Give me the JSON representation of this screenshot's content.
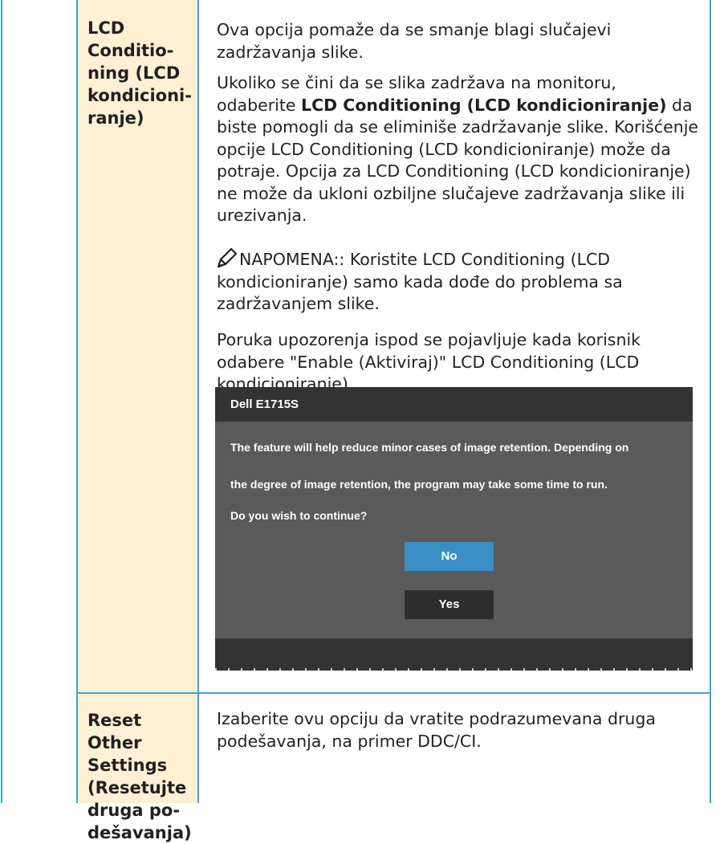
{
  "rows": [
    {
      "setting": "LCD Conditio-\nning (LCD\nkondicioni-\nranje)",
      "paragraphs": [
        "Ova opcija pomaže da se smanje blagi slučajevi zadržavanja slike.",
        {
          "before": "Ukoliko se čini da se slika zadržava na monitoru, odaberite ",
          "bold": "LCD Conditioning (LCD kondicioniranje)",
          "after": " da biste pomogli da se eliminiše zadržavanje slike. Korišćenje opcije LCD Conditioning (LCD kondicioniranje) može da potraje. Opcija za LCD Conditioning (LCD kondicioniranje) ne može da ukloni ozbiljne slučajeve zadržavanja slike ili urezivanja."
        }
      ],
      "note": {
        "label": "NAPOMENA:",
        "text": ": Koristite LCD Conditioning (LCD kondicioniranje) samo kada dođe do problema sa zadržavanjem slike."
      },
      "warning_intro": "Poruka upozorenja ispod se pojavljuje kada korisnik odabere \"Enable (Aktiviraj)\" LCD Conditioning (LCD kondicioniranje).",
      "dialog": {
        "title": "Dell E1715S",
        "line1": "The feature will help reduce minor cases of image retention. Depending on",
        "line2": "the degree of image retention, the program may take some time to run.",
        "line3": "Do you wish to continue?",
        "no_label": "No",
        "yes_label": "Yes"
      }
    },
    {
      "setting": "Reset Other\nSettings\n(Resetujte\ndruga po-\ndešavanja)",
      "description": "Izaberite ovu opciju da vratite podrazumevana druga podešavanja, na primer DDC/CI."
    }
  ],
  "colors": {
    "border": "#3ba6cf",
    "setting_cell_bg": "#fdf0d3",
    "dialog_bg": "#5a5a5a",
    "dialog_bar": "#333333",
    "no_button": "#3a8fc7",
    "yes_button": "#2d2d2d"
  },
  "icons": {
    "note": "pencil-note-icon"
  }
}
